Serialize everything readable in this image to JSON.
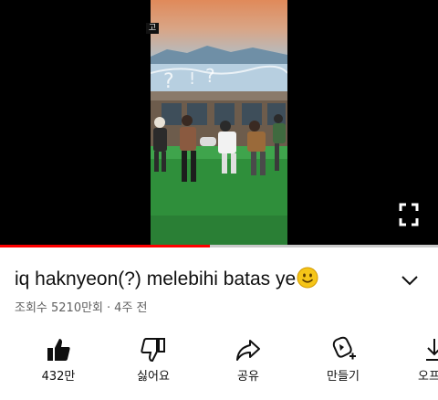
{
  "player": {
    "corner_label": "고",
    "progress_fraction": 0.48,
    "colors": {
      "progress": "#ff0000",
      "track": "#c9c9c9",
      "background": "#000000"
    }
  },
  "video": {
    "title": "iq haknyeon(?) melebihi batas ye",
    "title_emoji": "slightly-smiling-face",
    "views": "조회수 5210만회",
    "separator": "·",
    "age": "4주 전"
  },
  "actions": [
    {
      "icon": "thumbs-up-filled-icon",
      "label": "432만"
    },
    {
      "icon": "thumbs-down-icon",
      "label": "싫어요"
    },
    {
      "icon": "share-arrow-icon",
      "label": "공유"
    },
    {
      "icon": "create-remix-icon",
      "label": "만들기"
    },
    {
      "icon": "download-icon",
      "label": "오프라"
    }
  ]
}
